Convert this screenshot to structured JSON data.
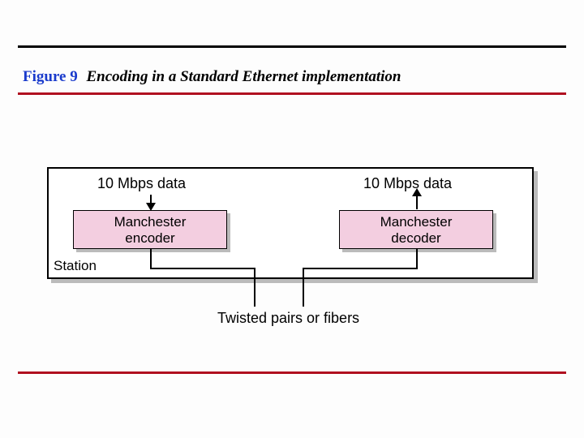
{
  "figure": {
    "label": "Figure 9",
    "caption": "Encoding in a Standard Ethernet implementation"
  },
  "diagram": {
    "data_label_left": "10 Mbps data",
    "data_label_right": "10 Mbps data",
    "encoder_label": "Manchester\nencoder",
    "decoder_label": "Manchester\ndecoder",
    "station_label": "Station",
    "medium_label": "Twisted pairs or fibers"
  },
  "colors": {
    "accent_red": "#b01020",
    "accent_blue": "#1a3bcc",
    "box_fill": "#f3cee0"
  }
}
